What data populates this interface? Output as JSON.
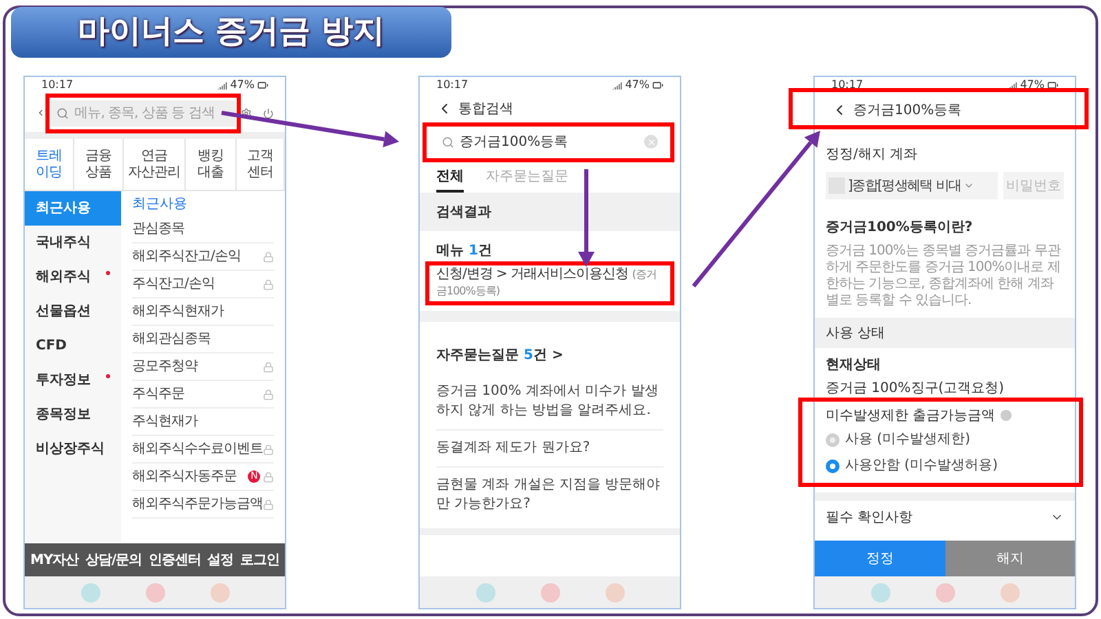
{
  "title": "마이너스 증거금 방지",
  "screens": [
    {
      "kind": "menu",
      "time": "10:17",
      "battery": "47%",
      "search": {
        "placeholder": "메뉴, 종목, 상품 등 검색",
        "highlighted": true
      },
      "tabs": [
        {
          "lines": [
            "트레",
            "이딩"
          ],
          "selected": true
        },
        {
          "lines": [
            "금융",
            "상품"
          ],
          "selected": false
        },
        {
          "lines": [
            "연금",
            "자산관리"
          ],
          "selected": false
        },
        {
          "lines": [
            "뱅킹",
            "대출"
          ],
          "selected": false
        },
        {
          "lines": [
            "고객",
            "센터"
          ],
          "selected": false
        }
      ],
      "categories": [
        {
          "label": "최근사용",
          "selected": true,
          "dot": false
        },
        {
          "label": "국내주식",
          "selected": false,
          "dot": false
        },
        {
          "label": "해외주식",
          "selected": false,
          "dot": true
        },
        {
          "label": "선물옵션",
          "selected": false,
          "dot": false
        },
        {
          "label": "CFD",
          "selected": false,
          "dot": false
        },
        {
          "label": "투자정보",
          "selected": false,
          "dot": true
        },
        {
          "label": "종목정보",
          "selected": false,
          "dot": false
        },
        {
          "label": "비상장주식",
          "selected": false,
          "dot": false
        }
      ],
      "section_title": "최근사용",
      "items": [
        {
          "label": "관심종목",
          "locked": false
        },
        {
          "label": "해외주식잔고/손익",
          "locked": true
        },
        {
          "label": "주식잔고/손익",
          "locked": true
        },
        {
          "label": "해외주식현재가",
          "locked": false
        },
        {
          "label": "해외관심종목",
          "locked": false
        },
        {
          "label": "공모주청약",
          "locked": true
        },
        {
          "label": "주식주문",
          "locked": true
        },
        {
          "label": "주식현재가",
          "locked": false
        },
        {
          "label": "해외주식수수료이벤트",
          "locked": true
        },
        {
          "label": "해외주식자동주문",
          "locked": true,
          "badge": "N"
        },
        {
          "label": "해외주식주문가능금액",
          "locked": true
        }
      ],
      "bottom_menu": [
        "MY자산",
        "상담/문의",
        "인증센터",
        "설정",
        "로그인"
      ]
    },
    {
      "kind": "search",
      "time": "10:17",
      "battery": "47%",
      "header": "통합검색",
      "search": {
        "value": "증거금100%등록",
        "highlighted": true
      },
      "tabs": [
        {
          "label": "전체",
          "selected": true
        },
        {
          "label": "자주묻는질문",
          "selected": false
        }
      ],
      "section_title": "검색결과",
      "menu_results": {
        "label": "메뉴",
        "count": "1",
        "unit": "건",
        "items": [
          {
            "path": "신청/변경 > 거래서비스이용신청",
            "note": "(증거금100%등록)",
            "highlighted": true
          }
        ]
      },
      "faq": {
        "label": "자주묻는질문",
        "count": "5",
        "unit": "건",
        "more": ">",
        "items": [
          "증거금 100% 계좌에서 미수가 발생하지 않게 하는 방법을 알려주세요.",
          "동결계좌 제도가 뭔가요?",
          "금현물 계좌 개설은 지점을 방문해야만 가능한가요?"
        ]
      }
    },
    {
      "kind": "form",
      "time": "10:17",
      "battery": "47%",
      "header": {
        "title": "증거금100%등록",
        "highlighted": true
      },
      "account_label": "정정/해지 계좌",
      "account_value": "]종합[평생혜택 비대",
      "password_placeholder": "비밀번호",
      "info_title": "증거금100%등록이란?",
      "info_text": "증거금 100%는 종목별 증거금률과 무관하게 주문한도를 증거금 100%이내로 제한하는 기능으로, 종합계좌에 한해 계좌별로 등록할 수 있습니다.",
      "section_title": "사용 상태",
      "status_label": "현재상태",
      "status_value": "증거금 100%징구(고객요청)",
      "option_group": {
        "label": "미수발생제한 출금가능금액",
        "highlighted": true,
        "options": [
          {
            "label": "사용 (미수발생제한)",
            "selected": false
          },
          {
            "label": "사용안함 (미수발생허용)",
            "selected": true
          }
        ]
      },
      "notice": "필수 확인사항",
      "buttons": [
        {
          "label": "정정",
          "kind": "primary"
        },
        {
          "label": "해지",
          "kind": "secondary"
        }
      ]
    }
  ]
}
